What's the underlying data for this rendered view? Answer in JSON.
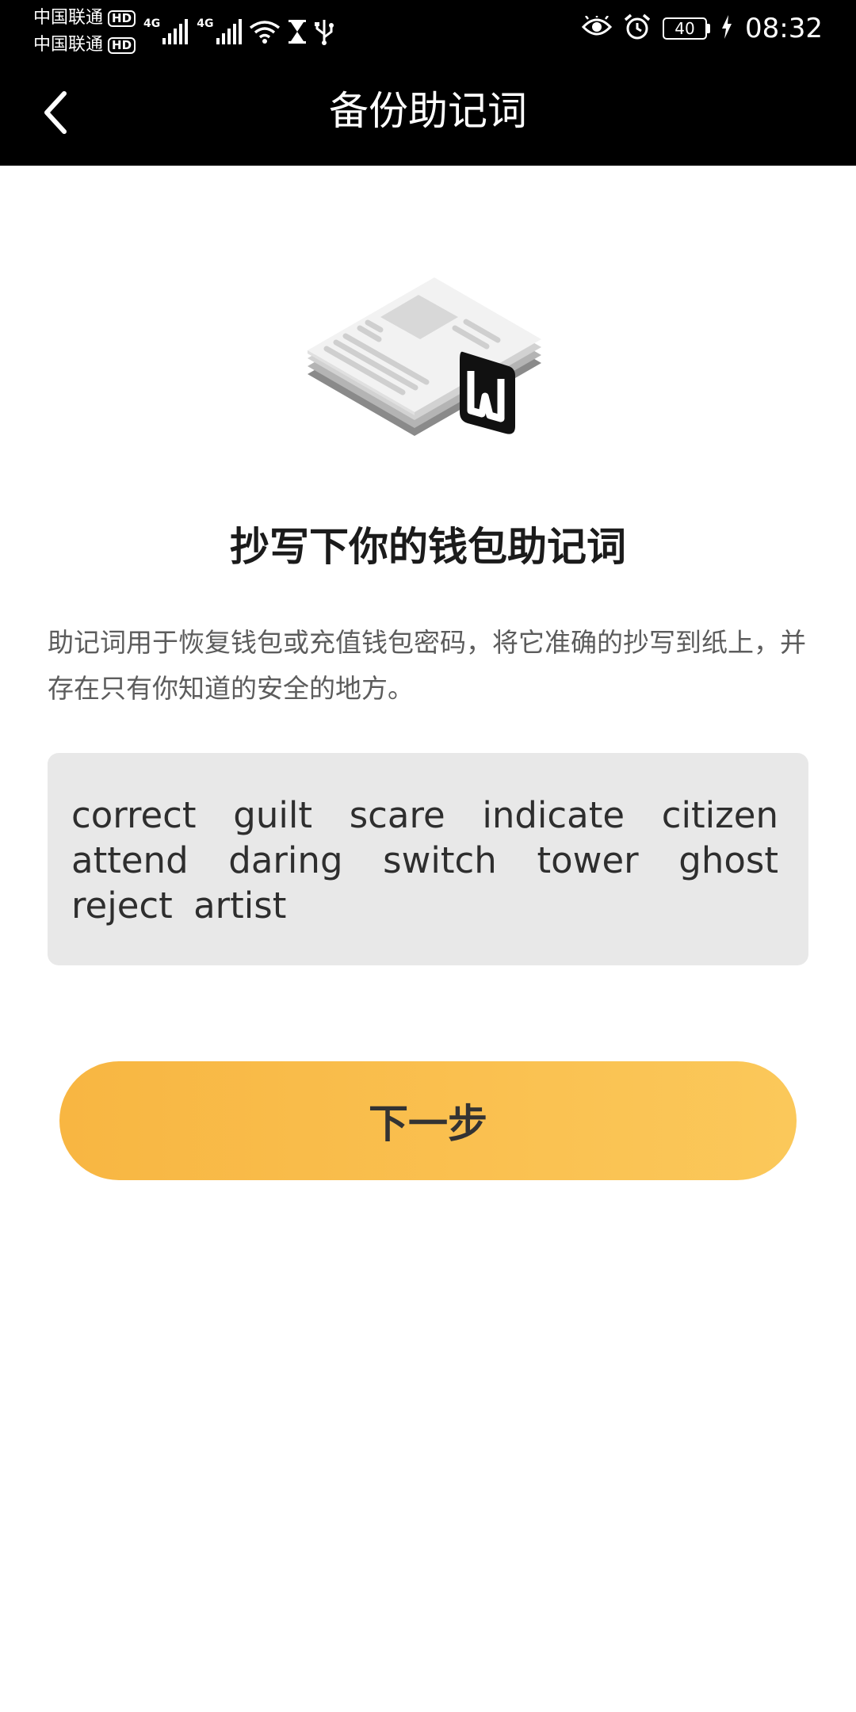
{
  "status_bar": {
    "carrier1": "中国联通",
    "carrier2": "中国联通",
    "hd": "HD",
    "network": "4G",
    "battery": "40",
    "time": "08:32"
  },
  "nav": {
    "title": "备份助记词"
  },
  "content": {
    "heading": "抄写下你的钱包助记词",
    "description": "助记词用于恢复钱包或充值钱包密码，将它准确的抄写到纸上，并存在只有你知道的安全的地方。",
    "mnemonic": "correct guilt scare indicate citizen attend daring switch tower ghost reject artist"
  },
  "actions": {
    "next_label": "下一步"
  },
  "colors": {
    "bar_background": "#000000",
    "button_gradient_start": "#f8b642",
    "button_gradient_end": "#fbc85a",
    "mnemonic_background": "#e8e8e8"
  }
}
